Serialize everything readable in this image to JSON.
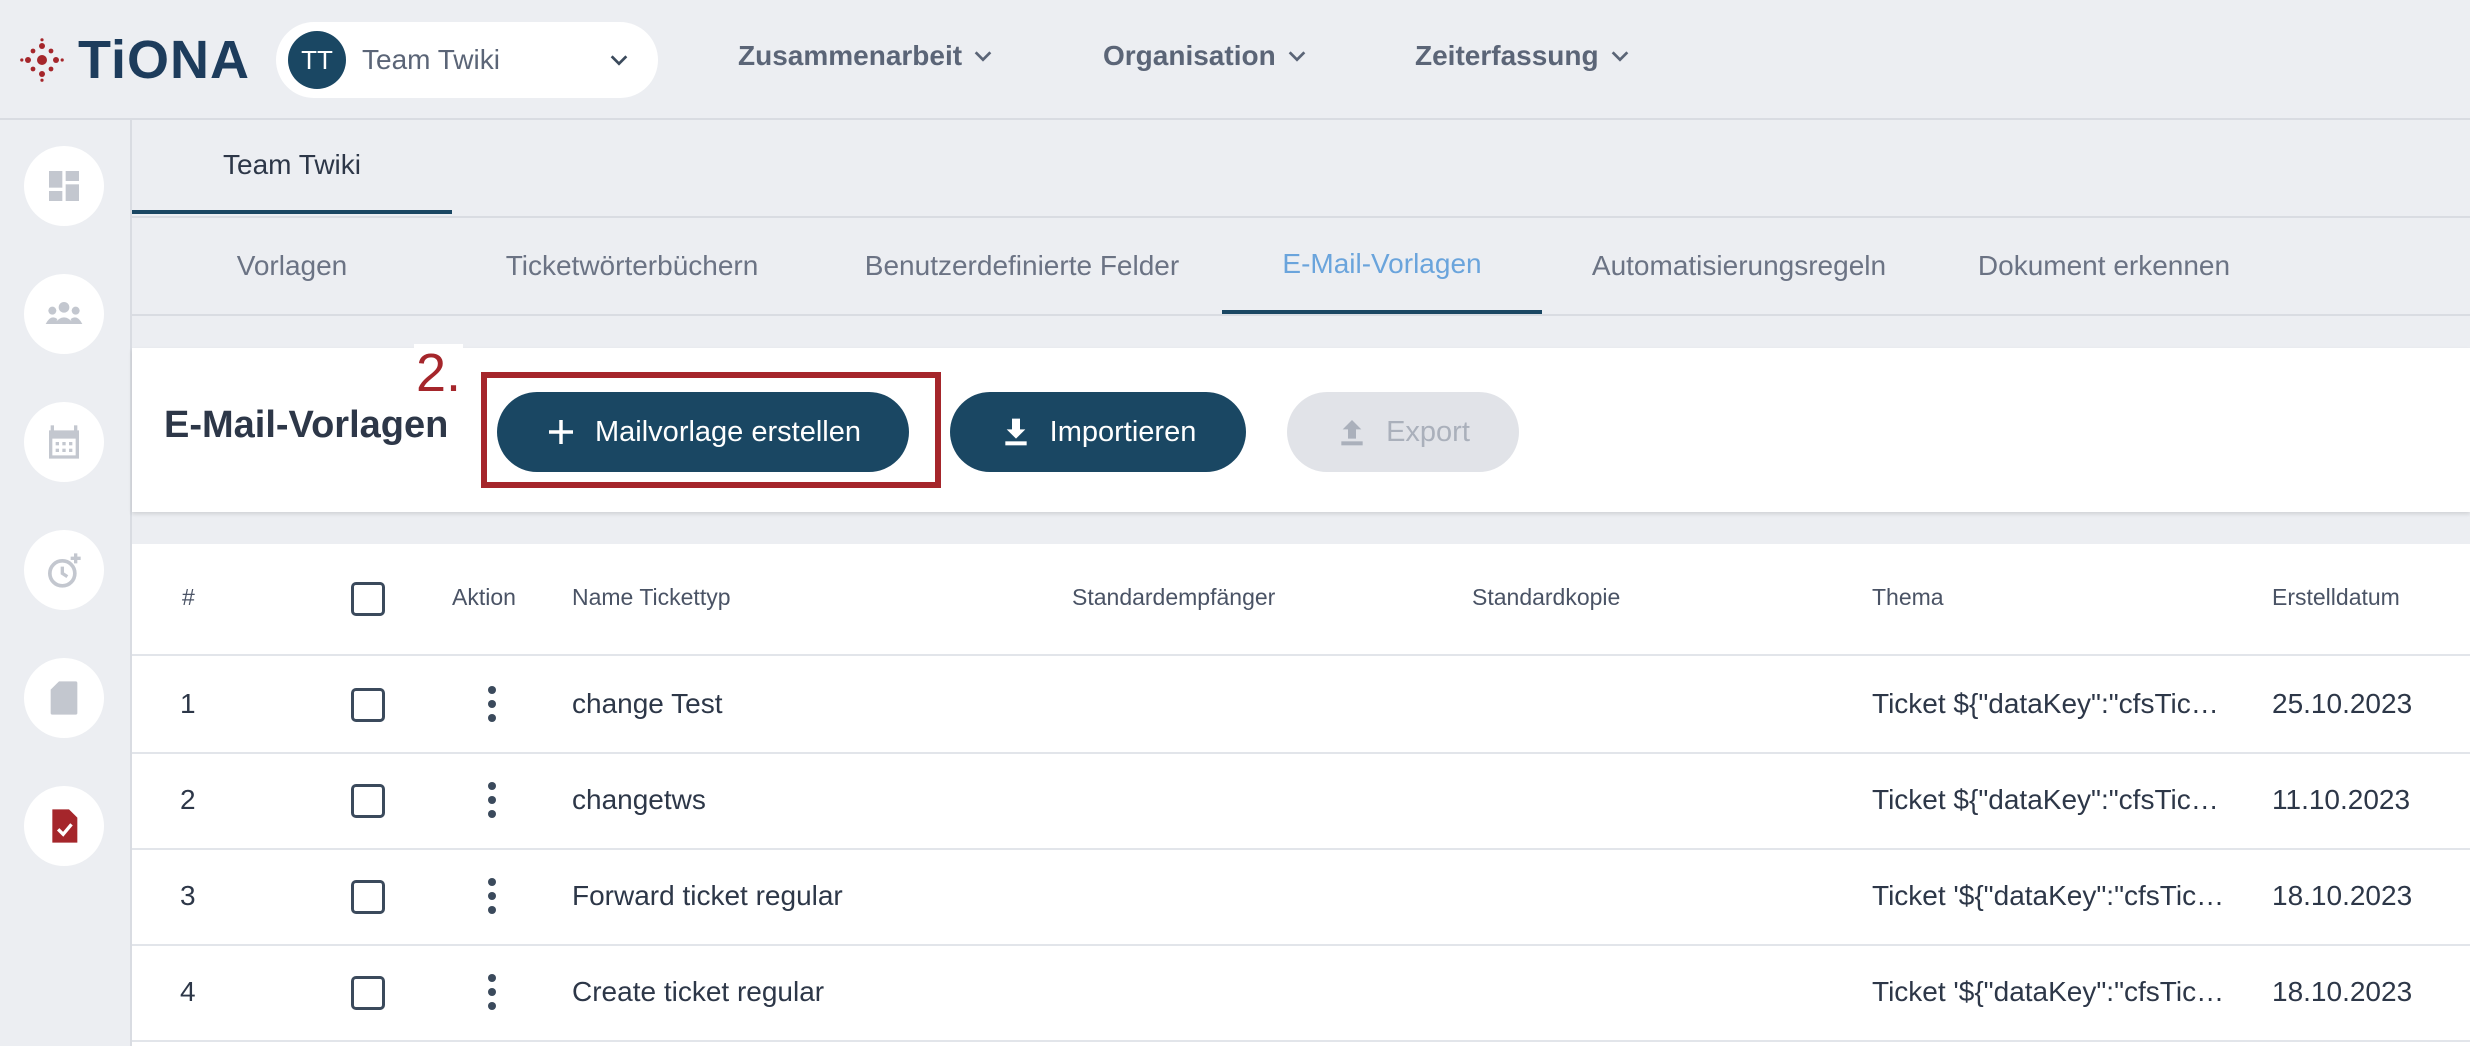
{
  "app": {
    "logo_text": "TiONA",
    "brand_color": "#a5262b",
    "primary_color": "#1a4763"
  },
  "team_select": {
    "avatar_initials": "TT",
    "name": "Team Twiki"
  },
  "top_nav": [
    {
      "label": "Zusammenarbeit"
    },
    {
      "label": "Organisation"
    },
    {
      "label": "Zeiterfassung"
    }
  ],
  "left_rail": [
    "dashboard-icon",
    "people-icon",
    "calendar-icon",
    "time-add-icon",
    "sd-card-icon",
    "task-icon"
  ],
  "team_tab": {
    "label": "Team Twiki"
  },
  "sub_tabs": [
    {
      "label": "Vorlagen",
      "active": false
    },
    {
      "label": "Ticketwörterbüchern",
      "active": false
    },
    {
      "label": "Benutzerdefinierte Felder",
      "active": false
    },
    {
      "label": "E-Mail-Vorlagen",
      "active": true
    },
    {
      "label": "Automatisierungsregeln",
      "active": false
    },
    {
      "label": "Dokument erkennen",
      "active": false
    }
  ],
  "toolbar": {
    "title": "E-Mail-Vorlagen",
    "step_label": "2.",
    "create_label": "Mailvorlage erstellen",
    "import_label": "Importieren",
    "export_label": "Export"
  },
  "table": {
    "headers": {
      "index": "#",
      "action": "Aktion",
      "name": "Name Tickettyp",
      "recipient": "Standardempfänger",
      "cc": "Standardkopie",
      "subject": "Thema",
      "created": "Erstelldatum"
    },
    "rows": [
      {
        "index": "1",
        "name": "change Test",
        "recipient": "",
        "cc": "",
        "subject": "Ticket ${\"dataKey\":\"cfsTick...",
        "created": "25.10.2023"
      },
      {
        "index": "2",
        "name": "changetws",
        "recipient": "",
        "cc": "",
        "subject": "Ticket ${\"dataKey\":\"cfsTick...",
        "created": "11.10.2023"
      },
      {
        "index": "3",
        "name": "Forward ticket regular",
        "recipient": "",
        "cc": "",
        "subject": "Ticket '${\"dataKey\":\"cfsTick...",
        "created": "18.10.2023"
      },
      {
        "index": "4",
        "name": "Create ticket regular",
        "recipient": "",
        "cc": "",
        "subject": "Ticket '${\"dataKey\":\"cfsTick...",
        "created": "18.10.2023"
      }
    ]
  }
}
